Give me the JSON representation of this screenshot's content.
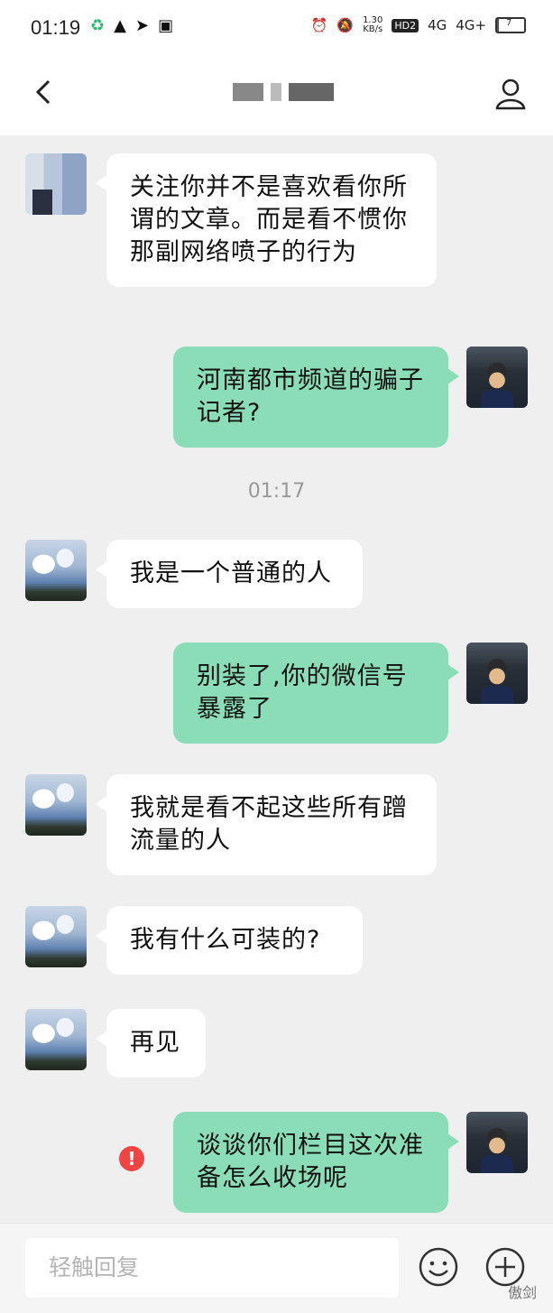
{
  "status_bar": {
    "time": "01:19",
    "rate_top": "1.30",
    "rate_bottom": "KB/s",
    "hd": "HD2",
    "net1": "4G",
    "net2": "4G+",
    "battery": "7"
  },
  "nav": {
    "back_icon": "chevron-left-icon",
    "profile_icon": "person-icon"
  },
  "messages": [
    {
      "side": "in",
      "avatar": "blurred",
      "text": "关注你并不是喜欢看你所谓的文章。而是看不惯你那副网络喷子的行为"
    },
    {
      "side": "out",
      "avatar": "self",
      "text": "河南都市频道的骗子记者?"
    },
    {
      "type": "time",
      "text": "01:17"
    },
    {
      "side": "in",
      "avatar": "sky",
      "text": "我是一个普通的人"
    },
    {
      "side": "out",
      "avatar": "self",
      "text": "别装了,你的微信号暴露了"
    },
    {
      "side": "in",
      "avatar": "sky",
      "text": "我就是看不起这些所有蹭流量的人"
    },
    {
      "side": "in",
      "avatar": "sky",
      "text": "我有什么可装的?"
    },
    {
      "side": "in",
      "avatar": "sky",
      "text": "再见"
    },
    {
      "side": "out",
      "avatar": "self",
      "text": "谈谈你们栏目这次准备怎么收场呢",
      "error": "!"
    }
  ],
  "input": {
    "placeholder": "轻触回复",
    "emoji_icon": "emoji-icon",
    "plus_icon": "plus-circle-icon"
  },
  "watermark": "傲剑"
}
